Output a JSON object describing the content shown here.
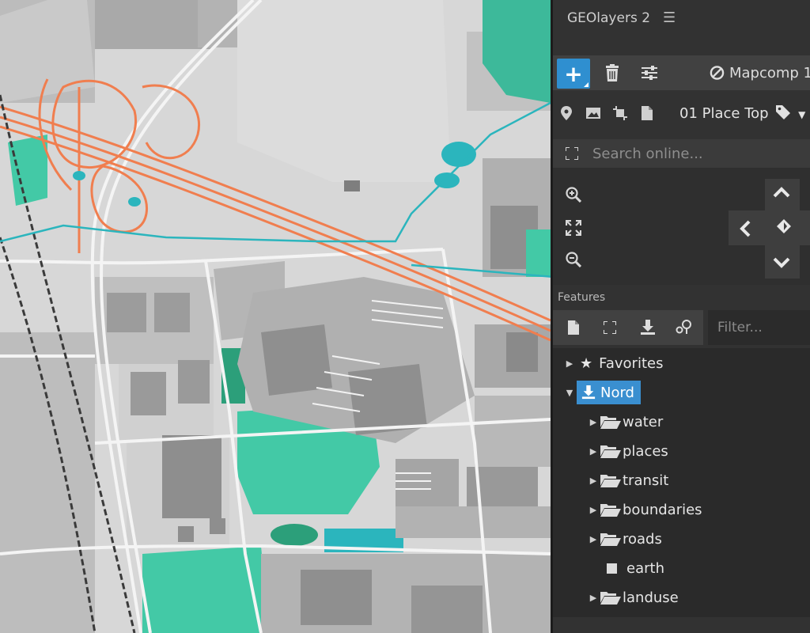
{
  "app": {
    "title": "GEOlayers 2"
  },
  "toolbar": {
    "mapcomp_label": "Mapcomp 1"
  },
  "layer": {
    "selected": "01 Place Top"
  },
  "search": {
    "placeholder": "Search online..."
  },
  "features": {
    "label": "Features",
    "filter_placeholder": "Filter...",
    "tree": [
      {
        "label": "Favorites"
      },
      {
        "label": "Nord"
      },
      {
        "label": "water"
      },
      {
        "label": "places"
      },
      {
        "label": "transit"
      },
      {
        "label": "boundaries"
      },
      {
        "label": "roads"
      },
      {
        "label": "earth"
      },
      {
        "label": "landuse"
      }
    ]
  },
  "colors": {
    "accent": "#3a8fd0",
    "map_green": "#45cba8",
    "motorway": "#f07e4f",
    "water_line": "#2bb5bd"
  }
}
